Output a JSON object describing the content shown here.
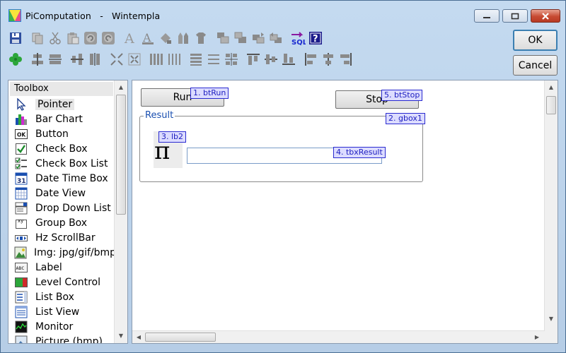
{
  "window": {
    "app_name": "PiComputation",
    "separator": "-",
    "app_title": "Wintempla"
  },
  "dialog": {
    "ok_label": "OK",
    "cancel_label": "Cancel"
  },
  "toolbox": {
    "header": "Toolbox",
    "items": [
      {
        "label": "Pointer",
        "icon": "pointer-icon",
        "selected": true
      },
      {
        "label": "Bar Chart",
        "icon": "bar-chart-icon"
      },
      {
        "label": "Button",
        "icon": "button-icon",
        "icon_text": "OK"
      },
      {
        "label": "Check Box",
        "icon": "check-box-icon"
      },
      {
        "label": "Check Box List",
        "icon": "check-box-list-icon"
      },
      {
        "label": "Date Time Box",
        "icon": "date-time-box-icon",
        "icon_text": "31"
      },
      {
        "label": "Date View",
        "icon": "date-view-icon"
      },
      {
        "label": "Drop Down List",
        "icon": "drop-down-list-icon"
      },
      {
        "label": "Group Box",
        "icon": "group-box-icon",
        "icon_text": "xy"
      },
      {
        "label": "Hz ScrollBar",
        "icon": "hz-scrollbar-icon"
      },
      {
        "label": "Img: jpg/gif/bmp",
        "icon": "image-icon"
      },
      {
        "label": "Label",
        "icon": "label-icon",
        "icon_text": "ABC"
      },
      {
        "label": "Level Control",
        "icon": "level-control-icon"
      },
      {
        "label": "List Box",
        "icon": "list-box-icon"
      },
      {
        "label": "List View",
        "icon": "list-view-icon"
      },
      {
        "label": "Monitor",
        "icon": "monitor-icon"
      },
      {
        "label": "Picture (bmp)",
        "icon": "picture-icon"
      }
    ]
  },
  "design": {
    "run_button": {
      "label": "Run",
      "tag": "1. btRun"
    },
    "stop_button": {
      "label": "Stop",
      "tag": "5. btStop"
    },
    "group_box": {
      "title": "Result",
      "tag": "2. gbox1"
    },
    "pi_label": {
      "text": "π",
      "tag": "3. lb2"
    },
    "result_box": {
      "value": "",
      "tag": "4. tbxResult"
    }
  },
  "toolbar_icons": {
    "row1": [
      "save-icon",
      "copy-icon",
      "cut-icon",
      "paste-icon",
      "undo-icon",
      "redo-icon",
      "font-icon",
      "font-color-icon",
      "fill-icon",
      "pencils-icon",
      "shirt-icon",
      "bring-front-icon",
      "send-back-icon",
      "move-forward-icon",
      "move-backward-icon",
      "sql-icon",
      "help-icon"
    ],
    "row2": [
      "clover-icon",
      "align-center-h-icon",
      "space-h-icon",
      "align-center-v-icon",
      "space-v-icon",
      "shrink-icon",
      "expand-icon",
      "distribute-cols-icon",
      "narrow-cols-icon",
      "distribute-rows-icon",
      "equal-rows-icon",
      "grid-icon",
      "align-top-icon",
      "align-middle-icon",
      "align-bottom-icon",
      "align-left-icon",
      "align-center-icon",
      "align-right-icon"
    ]
  },
  "colors": {
    "tag_border": "#2a2ad0",
    "tag_bg": "#dcdcff",
    "group_title": "#1a4fb0",
    "close_red": "#c74a32"
  }
}
